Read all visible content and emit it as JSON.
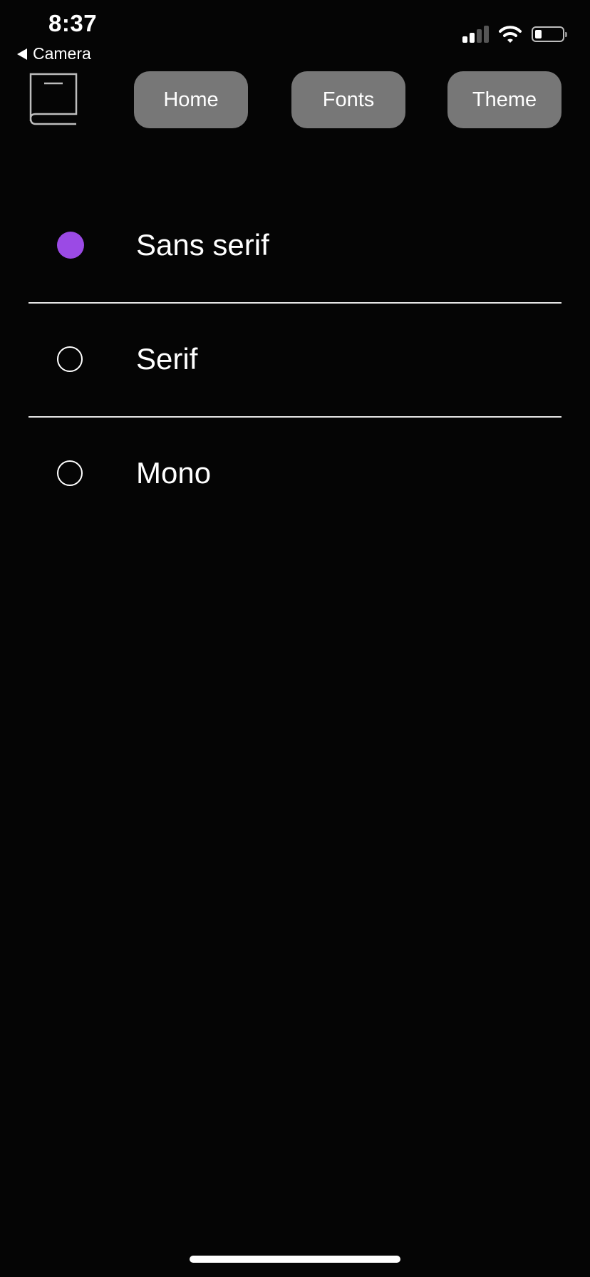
{
  "status_bar": {
    "time": "8:37",
    "back_label": "Camera",
    "icons": [
      "signal-icon",
      "wifi-icon",
      "battery-icon"
    ]
  },
  "nav": {
    "logo_icon": "book-icon",
    "buttons": [
      {
        "label": "Home"
      },
      {
        "label": "Fonts"
      },
      {
        "label": "Theme"
      }
    ]
  },
  "fonts": {
    "options": [
      {
        "label": "Sans serif",
        "selected": true
      },
      {
        "label": "Serif",
        "selected": false
      },
      {
        "label": "Mono",
        "selected": false
      }
    ]
  },
  "colors": {
    "background": "#050505",
    "accent": "#9b4ae5",
    "button": "#777777"
  }
}
